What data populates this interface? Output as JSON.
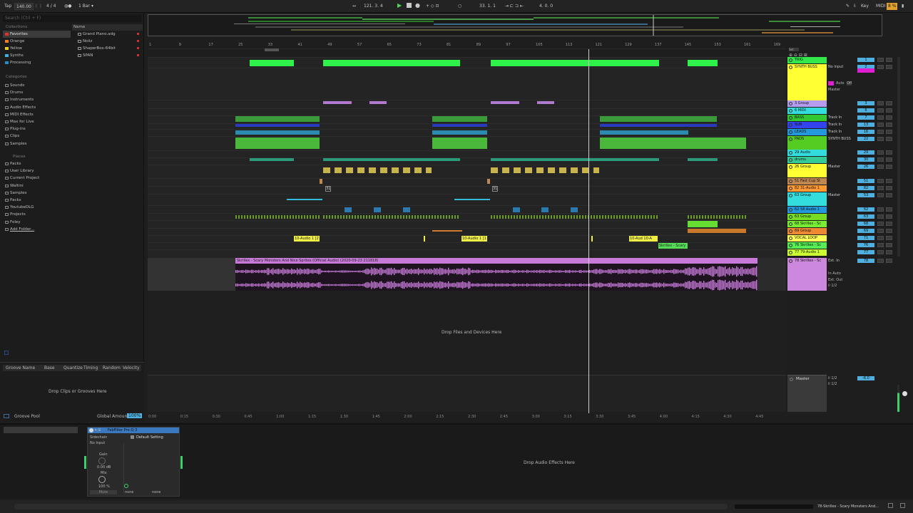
{
  "transport": {
    "tap": "Tap",
    "tempo": "140.00",
    "time_sig": "4 / 4",
    "quantize": "1 Bar",
    "position": "121.   3.   4",
    "loop_start": "33.   1.   1",
    "loop_len": "4.   0.   0",
    "key": "Key",
    "midi": "MIDI",
    "cpu": "8 %"
  },
  "browser": {
    "search_placeholder": "Search (Ctrl + F)",
    "collections_label": "Collections",
    "collections": [
      {
        "label": "Favorites",
        "color": "#e03030"
      },
      {
        "label": "Orange",
        "color": "#f08020"
      },
      {
        "label": "Yellow",
        "color": "#e8d020"
      },
      {
        "label": "Synths",
        "color": "#40b0e0"
      },
      {
        "label": "Processing",
        "color": "#2090c0"
      }
    ],
    "categories_label": "Categories",
    "categories": [
      "Sounds",
      "Drums",
      "Instruments",
      "Audio Effects",
      "MIDI Effects",
      "Max for Live",
      "Plug-ins",
      "Clips",
      "Samples"
    ],
    "places_label": "Places",
    "places": [
      "Packs",
      "User Library",
      "Current Project",
      "Waltini",
      "Samples",
      "Packs",
      "YoutubeDLG",
      "Projects",
      "Foley",
      "Add Folder..."
    ],
    "name_header": "Name",
    "files": [
      "Grand Piano.adg",
      "Noiiz",
      "ShaperBox-64bit",
      "SPAN"
    ]
  },
  "groove": {
    "headers": [
      "Groove Name",
      "Base",
      "Quantize",
      "Timing",
      "Random",
      "Velocity"
    ],
    "drop_hint": "Drop Clips or Grooves Here",
    "pool_label": "Groove Pool",
    "global_amount_label": "Global Amount",
    "global_amount_value": "100%"
  },
  "ruler": [
    "1",
    "9",
    "17",
    "25",
    "33",
    "41",
    "49",
    "57",
    "65",
    "73",
    "81",
    "89",
    "97",
    "105",
    "113",
    "121",
    "129",
    "137",
    "145",
    "153",
    "161",
    "169"
  ],
  "time_ruler": [
    "0:00",
    "0:15",
    "0:30",
    "0:45",
    "1:00",
    "1:15",
    "1:30",
    "1:45",
    "2:00",
    "2:15",
    "2:30",
    "2:45",
    "3:00",
    "3:15",
    "3:30",
    "3:45",
    "4:00",
    "4:15",
    "4:30",
    "4:45"
  ],
  "tracks": [
    {
      "name": "TRIG",
      "color": "#32e84a",
      "io": "",
      "vol": "1"
    },
    {
      "name": "SYNTH BUSS",
      "color": "#ffff33",
      "io": "No Input",
      "vol": "2"
    },
    {
      "name": "3 Group",
      "color": "#b69cf0",
      "io": "",
      "vol": "3"
    },
    {
      "name": "6 MIDI",
      "color": "#33dddd",
      "io": "",
      "vol": "6"
    },
    {
      "name": "BASS",
      "color": "#32c832",
      "io": "Track In",
      "vol": "7"
    },
    {
      "name": "SUB",
      "color": "#3344ee",
      "io": "Track In",
      "vol": "13"
    },
    {
      "name": "LEADS",
      "color": "#2299dd",
      "io": "Track In",
      "vol": "16"
    },
    {
      "name": "PADS",
      "color": "#55cc22",
      "io": "SYNTH BUSS",
      "vol": "22"
    },
    {
      "name": "29 Audio",
      "color": "#33dddd",
      "io": "",
      "vol": "29"
    },
    {
      "name": "drums",
      "color": "#33cc99",
      "io": "",
      "vol": "30"
    },
    {
      "name": "26 Group",
      "color": "#ffff33",
      "io": "Master",
      "vol": "26"
    },
    {
      "name": "51 Fast Cup St",
      "color": "#c08850",
      "io": "",
      "vol": "51"
    },
    {
      "name": "82 31-Audio 1",
      "color": "#ff9933",
      "io": "",
      "vol": "82"
    },
    {
      "name": "63 Group",
      "color": "#33dddd",
      "io": "Master",
      "vol": "53"
    },
    {
      "name": "62 58 Audio 1",
      "color": "#2299dd",
      "io": "",
      "vol": "62"
    },
    {
      "name": "63 Group",
      "color": "#77dd22",
      "io": "",
      "vol": "63"
    },
    {
      "name": "68 Skrillex - Sc",
      "color": "#77ee33",
      "io": "",
      "vol": "68"
    },
    {
      "name": "69 Group",
      "color": "#ee8833",
      "io": "",
      "vol": "69"
    },
    {
      "name": "VOCAL LOOP",
      "color": "#ffff55",
      "io": "",
      "vol": "71"
    },
    {
      "name": "76 Skrillex - Sc",
      "color": "#55ee55",
      "io": "",
      "vol": "76"
    },
    {
      "name": "77 79-Audio 1",
      "color": "#ccff33",
      "io": "",
      "vol": "77"
    },
    {
      "name": "78 Skrillex - Sc",
      "color": "#cc88dd",
      "io": "Ext. In",
      "vol": "78"
    }
  ],
  "audio_clip": {
    "title": "Skrillex - Scary Monsters And Nice Sprites (Official Audio) (2020-09-23 211818)",
    "title_short": "Skrillex - Scary"
  },
  "clip_labels": {
    "audio1a": "10-Audio 1 [2",
    "audio1b": "10-Audio 1 [1",
    "audio1c": "10-Aud 10-A",
    "skrillex": "Skrillex - Scary",
    "n31": "31",
    "n31b": "31"
  },
  "io_extra": {
    "auto": "Auto",
    "off": "Off",
    "master": "Master",
    "inout": "In Auto",
    "ext_out": "Ext. Out",
    "half": "ii 1/2"
  },
  "drop_files": "Drop Files and Devices Here",
  "master": {
    "name": "Master",
    "vol": "-6.0"
  },
  "device": {
    "title": "FabFilter Pro-Q 3",
    "sidechain": "Sidechain",
    "input": "No Input",
    "preset": "Default Setting",
    "gain_label": "Gain",
    "gain_value": "0.00 dB",
    "mix_label": "Mix",
    "mix_value": "100 %",
    "none1": "none",
    "none2": "none",
    "mute": "Mute",
    "drop_hint": "Drop Audio Effects Here"
  },
  "status": {
    "track": "78-Skrillex - Scary Monsters And..."
  }
}
